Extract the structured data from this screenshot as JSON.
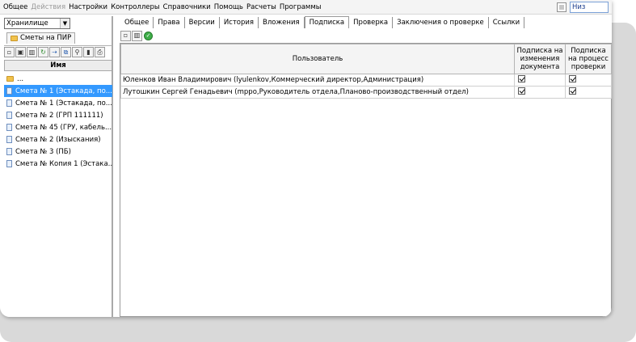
{
  "menu": {
    "items": [
      {
        "label": "Общее",
        "enabled": true
      },
      {
        "label": "Действия",
        "enabled": false
      },
      {
        "label": "Настройки",
        "enabled": true
      },
      {
        "label": "Контроллеры",
        "enabled": true
      },
      {
        "label": "Справочники",
        "enabled": true
      },
      {
        "label": "Помощь",
        "enabled": true
      },
      {
        "label": "Расчеты",
        "enabled": true
      },
      {
        "label": "Программы",
        "enabled": true
      }
    ],
    "position_field_value": "Низ"
  },
  "left_panel": {
    "storage_select_value": "Хранилище",
    "tab_label": "Сметы на ПИР",
    "toolbar_icons": [
      "new-doc-icon",
      "save-icon",
      "delete-icon",
      "refresh-icon",
      "move-icon",
      "copy-icon",
      "search-icon",
      "stats-icon",
      "print-icon"
    ],
    "column_header": "Имя",
    "tree": [
      {
        "label": "...",
        "type": "folder",
        "selected": false
      },
      {
        "label": "Смета № 1 (Эстакада, по...",
        "type": "doc",
        "selected": true
      },
      {
        "label": "Смета № 1 (Эстакада, по...",
        "type": "doc",
        "selected": false
      },
      {
        "label": "Смета № 2 (ГРП 111111)",
        "type": "doc",
        "selected": false
      },
      {
        "label": "Смета № 45 (ГРУ, кабель...",
        "type": "doc",
        "selected": false
      },
      {
        "label": "Смета № 2 (Изыскания)",
        "type": "doc",
        "selected": false
      },
      {
        "label": "Смета № 3 (ПБ)",
        "type": "doc",
        "selected": false
      },
      {
        "label": "Смета № Копия 1 (Эстака...",
        "type": "doc",
        "selected": false
      }
    ]
  },
  "right_panel": {
    "tabs": [
      {
        "label": "Общее",
        "active": false
      },
      {
        "label": "Права",
        "active": false
      },
      {
        "label": "Версии",
        "active": false
      },
      {
        "label": "История",
        "active": false
      },
      {
        "label": "Вложения",
        "active": false
      },
      {
        "label": "Подписка",
        "active": true
      },
      {
        "label": "Проверка",
        "active": false
      },
      {
        "label": "Заключения о проверке",
        "active": false
      },
      {
        "label": "Ссылки",
        "active": false
      }
    ],
    "toolbar_icons": [
      "add-icon",
      "delete-icon",
      "confirm-icon"
    ],
    "grid": {
      "headers": {
        "user": "Пользователь",
        "sub_changes": "Подписка на изменения документа",
        "sub_check": "Подписка на процесс проверки"
      },
      "rows": [
        {
          "user": "Юленков Иван Владимирович (lyulenkov,Коммерческий директор,Администрация)",
          "sub_changes": true,
          "sub_check": true
        },
        {
          "user": "Лутошкин Сергей Генадьевич (mppo,Руководитель отдела,Планово-производственный отдел)",
          "sub_changes": true,
          "sub_check": true
        }
      ]
    }
  },
  "colors": {
    "selection": "#3399ff",
    "disabled_text": "#9a9a9a",
    "ok_green": "#3fae49"
  }
}
